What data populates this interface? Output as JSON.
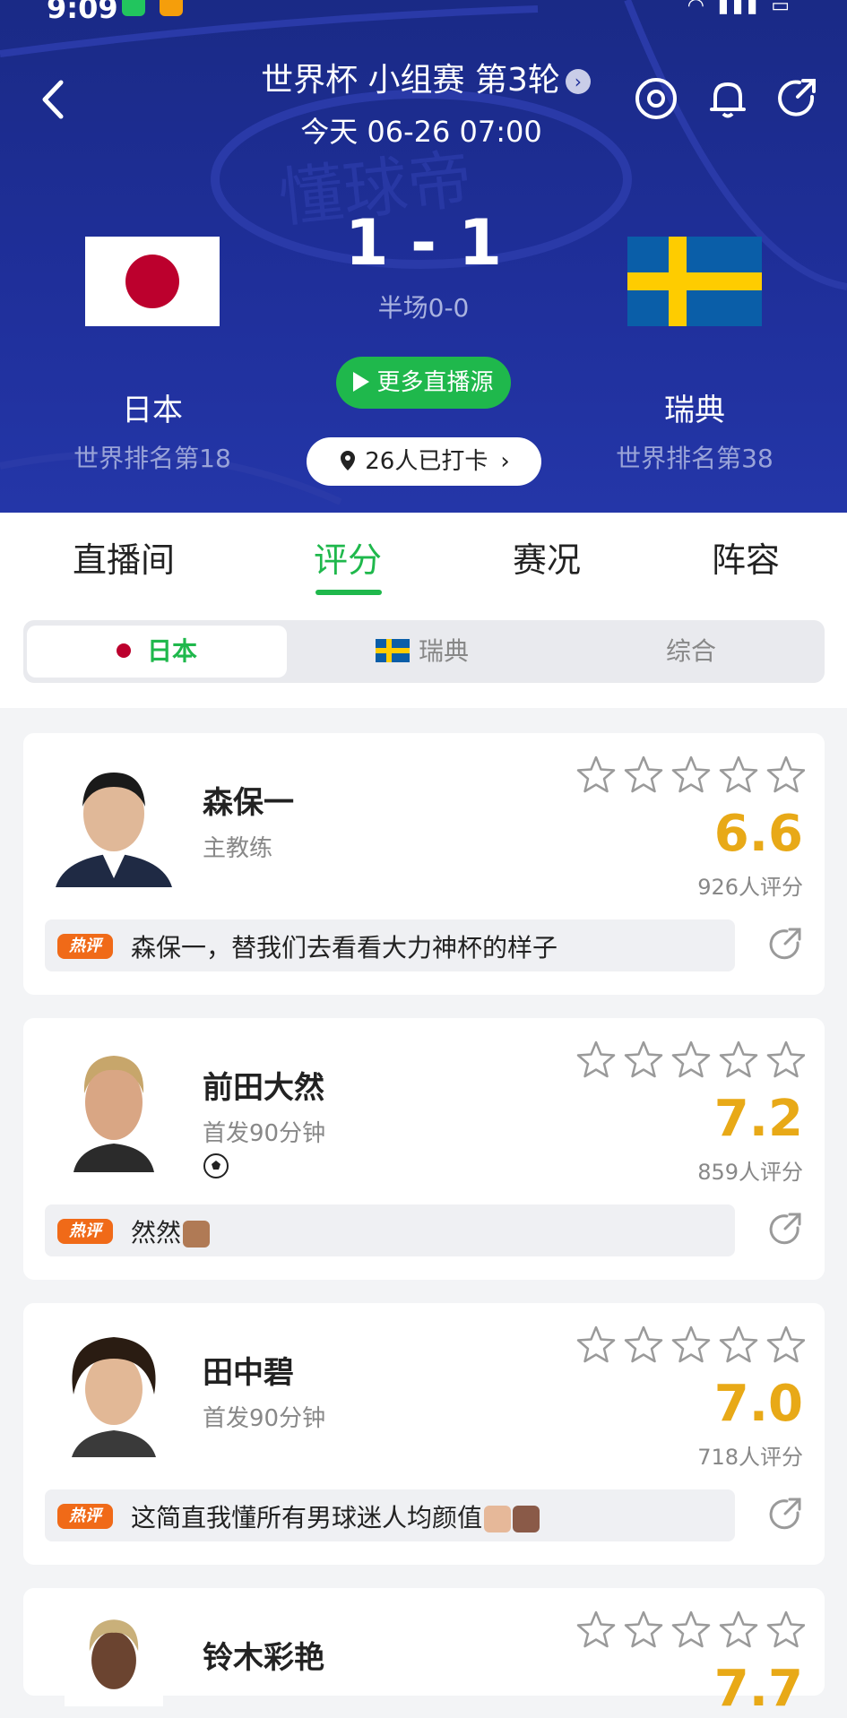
{
  "status_bar": {
    "time": "9:09"
  },
  "header": {
    "title": "世界杯 小组赛 第3轮",
    "datetime": "今天 06-26 07:00",
    "score": "1 - 1",
    "half_time": "半场0-0",
    "live_button": "更多直播源",
    "checkin": "26人已打卡",
    "home": {
      "name": "日本",
      "rank": "世界排名第18",
      "flag": "japan-flag"
    },
    "away": {
      "name": "瑞典",
      "rank": "世界排名第38",
      "flag": "sweden-flag"
    },
    "icons": [
      "back-icon",
      "target-icon",
      "bell-icon",
      "share-icon"
    ]
  },
  "tabs": [
    {
      "label": "直播间",
      "active": false
    },
    {
      "label": "评分",
      "active": true
    },
    {
      "label": "赛况",
      "active": false
    },
    {
      "label": "阵容",
      "active": false
    }
  ],
  "segment": [
    {
      "label": "日本",
      "active": true
    },
    {
      "label": "瑞典",
      "active": false
    },
    {
      "label": "综合",
      "active": false
    }
  ],
  "players": [
    {
      "name": "森保一",
      "role": "主教练",
      "rating": "6.6",
      "votes": "926人评分",
      "hot_label": "热评",
      "comment": "森保一，替我们去看看大力神杯的样子",
      "goal_icon": false
    },
    {
      "name": "前田大然",
      "role": "首发90分钟",
      "rating": "7.2",
      "votes": "859人评分",
      "hot_label": "热评",
      "comment": "然然",
      "goal_icon": true
    },
    {
      "name": "田中碧",
      "role": "首发90分钟",
      "rating": "7.0",
      "votes": "718人评分",
      "hot_label": "热评",
      "comment": "这简直我懂所有男球迷人均颜值",
      "goal_icon": false
    },
    {
      "name": "铃木彩艳",
      "role": "",
      "rating": "7.7",
      "votes": "",
      "hot_label": "",
      "comment": "",
      "goal_icon": false
    }
  ],
  "colors": {
    "accent": "#1fb84c",
    "rating": "#e8a917",
    "header_bg": "#1f2f9a",
    "hot_badge": "#f06a18"
  }
}
